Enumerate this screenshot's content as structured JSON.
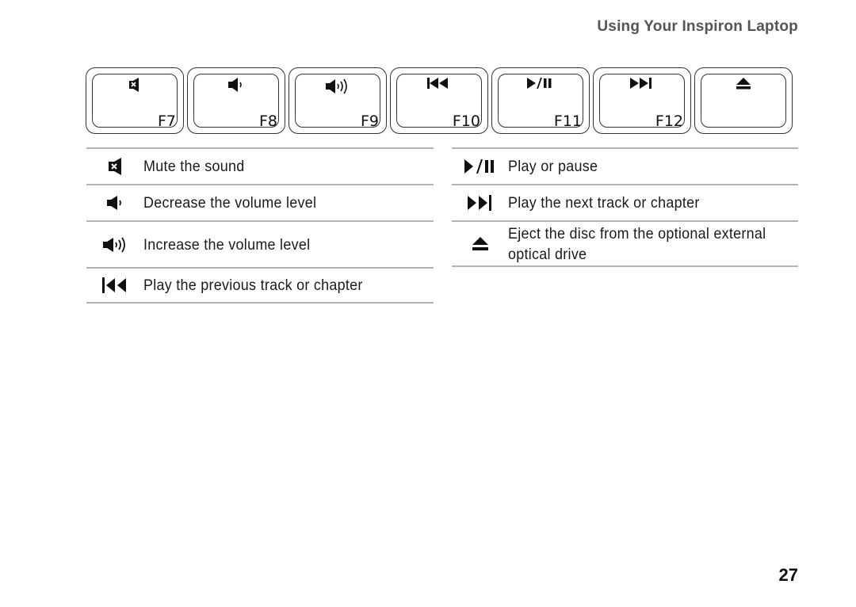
{
  "header": {
    "title": "Using Your Inspiron Laptop"
  },
  "keys": [
    {
      "label": "F7",
      "icon": "mute-icon"
    },
    {
      "label": "F8",
      "icon": "volume-down-icon"
    },
    {
      "label": "F9",
      "icon": "volume-up-icon"
    },
    {
      "label": "F10",
      "icon": "previous-track-icon"
    },
    {
      "label": "F11",
      "icon": "play-pause-icon"
    },
    {
      "label": "F12",
      "icon": "next-track-icon"
    },
    {
      "label": "",
      "icon": "eject-icon"
    }
  ],
  "legend": {
    "left": [
      {
        "icon": "mute-icon",
        "text": "Mute the sound"
      },
      {
        "icon": "volume-down-icon",
        "text": "Decrease the volume level"
      },
      {
        "icon": "volume-up-icon",
        "text": "Increase the volume level"
      },
      {
        "icon": "previous-track-icon",
        "text": "Play the previous track or chapter"
      }
    ],
    "right": [
      {
        "icon": "play-pause-icon",
        "text": "Play or pause"
      },
      {
        "icon": "next-track-icon",
        "text": "Play the next track or chapter"
      },
      {
        "icon": "eject-icon",
        "text": "Eject the disc from the optional external optical drive"
      }
    ]
  },
  "page_number": "27"
}
